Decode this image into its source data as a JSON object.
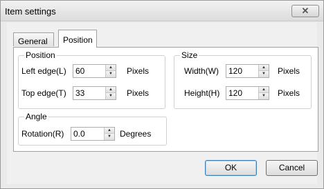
{
  "window": {
    "title": "Item settings",
    "close_glyph": "✕"
  },
  "tabs": [
    {
      "label": "General",
      "selected": false
    },
    {
      "label": "Position",
      "selected": true
    }
  ],
  "position_group": {
    "legend": "Position",
    "left_edge": {
      "label": "Left edge(L)",
      "value": "60",
      "unit": "Pixels"
    },
    "top_edge": {
      "label": "Top edge(T)",
      "value": "33",
      "unit": "Pixels"
    }
  },
  "size_group": {
    "legend": "Size",
    "width": {
      "label": "Width(W)",
      "value": "120",
      "unit": "Pixels"
    },
    "height": {
      "label": "Height(H)",
      "value": "120",
      "unit": "Pixels"
    }
  },
  "angle_group": {
    "legend": "Angle",
    "rotation": {
      "label": "Rotation(R)",
      "value": "0.0",
      "unit": "Degrees"
    }
  },
  "buttons": {
    "ok": "OK",
    "cancel": "Cancel"
  },
  "icons": {
    "spin_up": "up-arrow-icon",
    "spin_down": "down-arrow-icon",
    "close": "close-icon"
  },
  "colors": {
    "ok_border": "#3c7fb1",
    "window_bg": "#f0f0f0"
  }
}
